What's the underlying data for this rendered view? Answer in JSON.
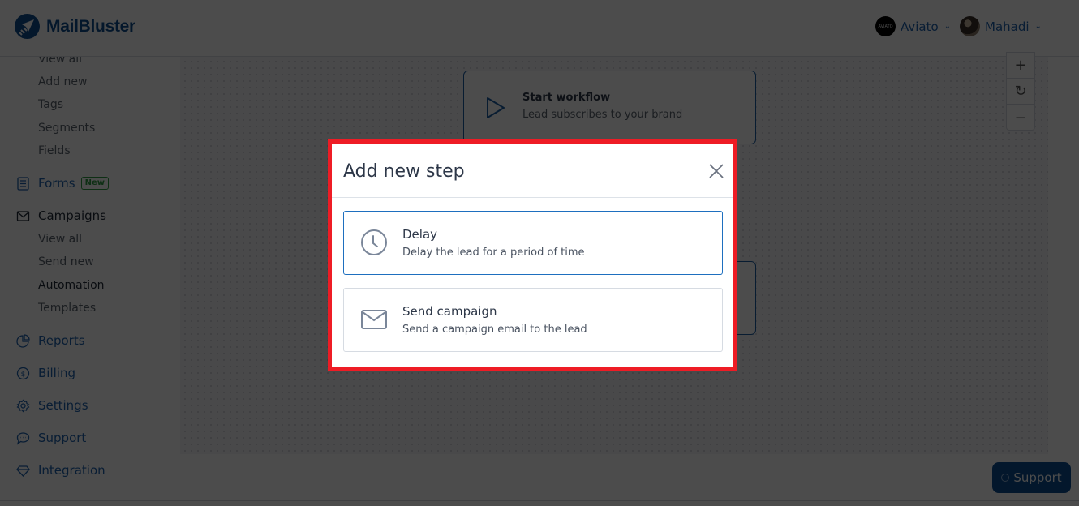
{
  "header": {
    "brand": "MailBluster",
    "brand_color": "#0f4f8f",
    "accounts": [
      {
        "name": "Aviato",
        "avatar_text": "AVIATO",
        "icon": "chevron-down-icon"
      },
      {
        "name": "Mahadi",
        "icon": "chevron-down-icon"
      }
    ]
  },
  "sidebar": {
    "subscribers_sub": [
      "View all",
      "Add new",
      "Tags",
      "Segments",
      "Fields"
    ],
    "forms": {
      "label": "Forms",
      "badge": "New"
    },
    "campaigns": {
      "label": "Campaigns",
      "sub": [
        "View all",
        "Send new",
        "Automation",
        "Templates"
      ],
      "active_sub": "Automation"
    },
    "main_items": [
      {
        "label": "Reports",
        "icon": "pie-chart-icon"
      },
      {
        "label": "Billing",
        "icon": "dollar-circle-icon"
      },
      {
        "label": "Settings",
        "icon": "gear-icon"
      },
      {
        "label": "Support",
        "icon": "chat-bubble-icon"
      },
      {
        "label": "Integration",
        "icon": "diamond-icon"
      }
    ]
  },
  "canvas": {
    "zoom_controls": {
      "zoom_in": "+",
      "reset": "↻",
      "zoom_out": "−"
    },
    "start_card": {
      "title": "Start workflow",
      "subtitle": "Lead subscribes to your brand"
    }
  },
  "support_button": "Support",
  "modal": {
    "title": "Add new step",
    "options": [
      {
        "title": "Delay",
        "description": "Delay the lead for a period of time",
        "icon": "clock-icon",
        "selected": true
      },
      {
        "title": "Send campaign",
        "description": "Send a campaign email to the lead",
        "icon": "envelope-icon",
        "selected": false
      }
    ],
    "highlight_color": "#ee1c25"
  }
}
